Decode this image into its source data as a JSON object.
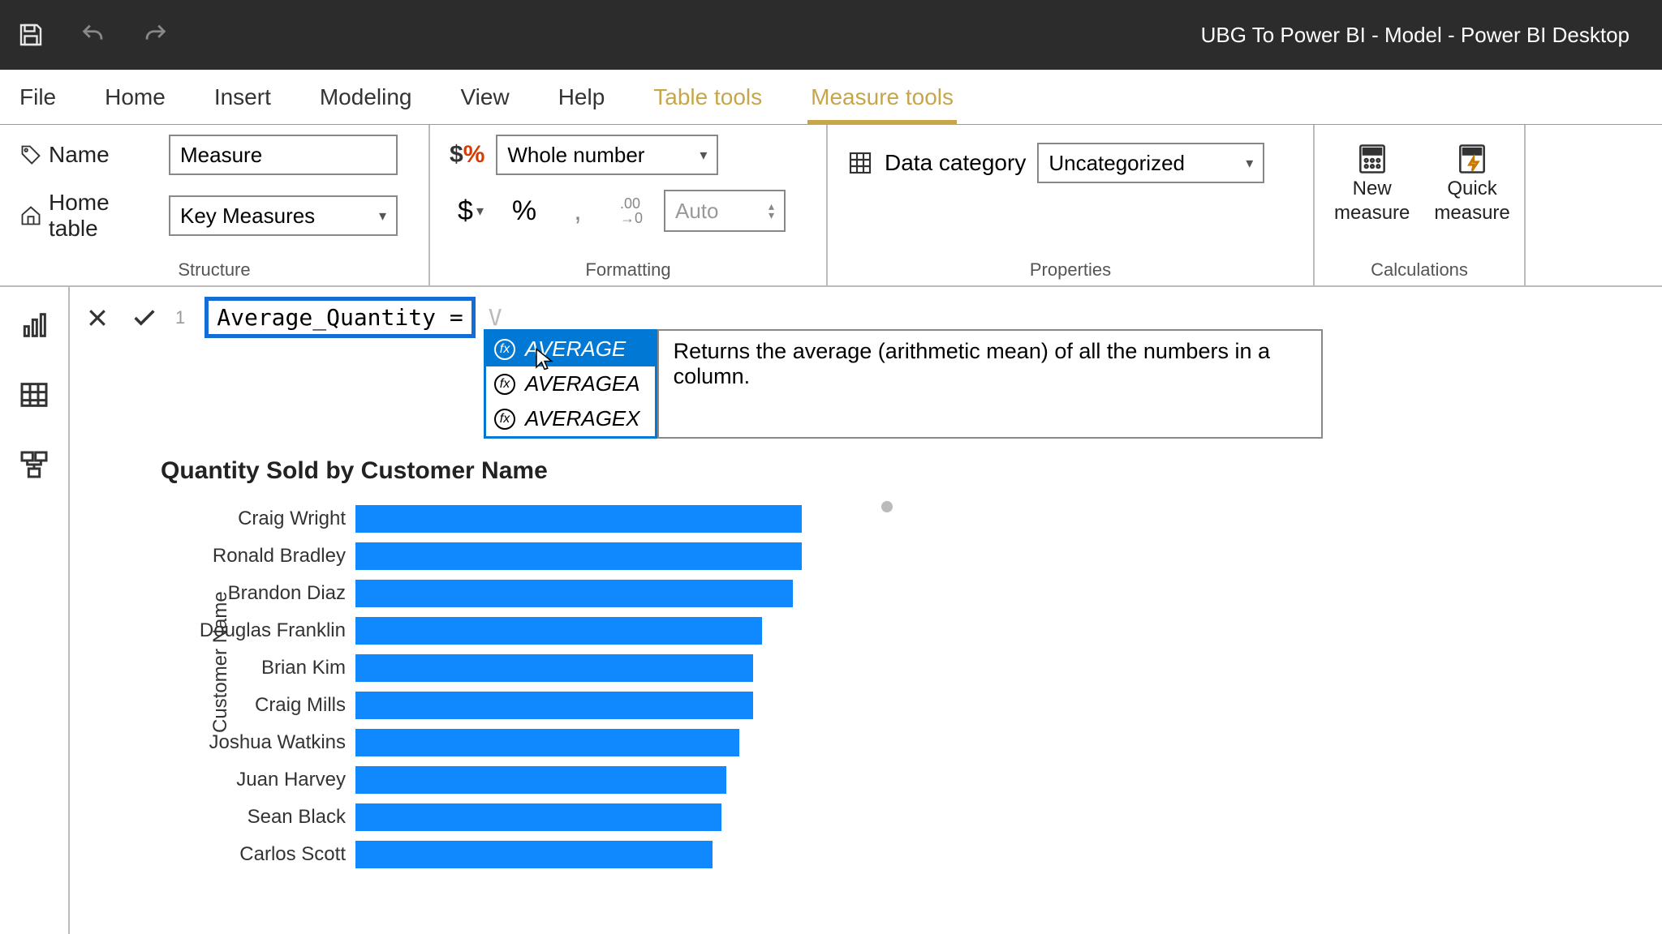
{
  "window_title": "UBG To Power BI - Model - Power BI Desktop",
  "ribbon_tabs": {
    "file": "File",
    "home": "Home",
    "insert": "Insert",
    "modeling": "Modeling",
    "view": "View",
    "help": "Help",
    "table_tools": "Table tools",
    "measure_tools": "Measure tools"
  },
  "structure": {
    "name_label": "Name",
    "name_value": "Measure",
    "home_table_label": "Home table",
    "home_table_value": "Key Measures",
    "group": "Structure"
  },
  "formatting": {
    "format_value": "Whole number",
    "auto_placeholder": "Auto",
    "group": "Formatting"
  },
  "properties": {
    "data_category_label": "Data category",
    "data_category_value": "Uncategorized",
    "group": "Properties"
  },
  "calculations": {
    "new_measure": "New\nmeasure",
    "quick_measure": "Quick\nmeasure",
    "group": "Calculations"
  },
  "formula": {
    "line": "1",
    "text": "Average_Quantity = ",
    "ghost": "V"
  },
  "intellisense": {
    "items": [
      "AVERAGE",
      "AVERAGEA",
      "AVERAGEX"
    ],
    "selected_index": 0,
    "tooltip": "Returns the average (arithmetic mean) of all the numbers in a column."
  },
  "chart_data": {
    "type": "bar",
    "title": "Quantity Sold by Customer Name",
    "ylabel": "Customer Name",
    "categories": [
      "Craig Wright",
      "Ronald Bradley",
      "Brandon Diaz",
      "Douglas Franklin",
      "Brian Kim",
      "Craig Mills",
      "Joshua Watkins",
      "Juan Harvey",
      "Sean Black",
      "Carlos Scott"
    ],
    "values": [
      100,
      100,
      98,
      91,
      89,
      89,
      86,
      83,
      82,
      80
    ],
    "xlim": [
      0,
      100
    ]
  }
}
